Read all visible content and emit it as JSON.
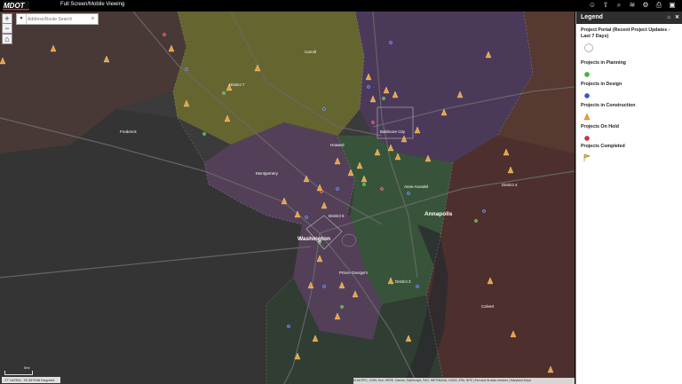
{
  "header": {
    "logo_text": "MDOT",
    "title": "Full Screen/Mobile Viewing",
    "icons": [
      "user-icon",
      "share-icon",
      "search-icon",
      "layers-icon",
      "gear-icon",
      "print-icon",
      "window-icon"
    ]
  },
  "map": {
    "search_placeholder": "Address/Route Search",
    "zoom_in": "+",
    "zoom_out": "−",
    "coordinates": "-77.142911, 78.337946 Degrees",
    "scale_label": "5mi",
    "attribution": "M-NCPPC, VGIN, Esri, HERE, Garmin, SafeGraph, FAO, METI/NASA, USGS, EPA, NPS | Esri and its data vendors | Maryland Depa",
    "city_labels": [
      "Washington",
      "Annapolis",
      "Baltimore City"
    ],
    "county_labels": [
      "Carroll",
      "Howard",
      "Montgomery",
      "Prince George's",
      "Anne Arundel",
      "District 5",
      "District 3",
      "District 7",
      "District 4",
      "Frederick",
      "Calvert"
    ]
  },
  "legend": {
    "title": "Legend",
    "items": [
      {
        "label": "Project Portal (Recent Project Updates - Last 7 Days)",
        "symbol": "circle-outline"
      },
      {
        "label": "Projects in Planning",
        "symbol": "green-dot"
      },
      {
        "label": "Projects in Design",
        "symbol": "blue-dot"
      },
      {
        "label": "Projects in Construction",
        "symbol": "cone"
      },
      {
        "label": "Projects On Hold",
        "symbol": "red-dot"
      },
      {
        "label": "Projects Completed",
        "symbol": "flag"
      }
    ]
  },
  "colors": {
    "district_olive": "#7a7a34",
    "district_purple": "#5a3f6a",
    "district_green": "#3a5a3c",
    "district_brown": "#5c3a30",
    "construction": "#f0a030",
    "planning": "#3bbf3b",
    "design": "#3a55e0",
    "hold": "#e0303a"
  }
}
